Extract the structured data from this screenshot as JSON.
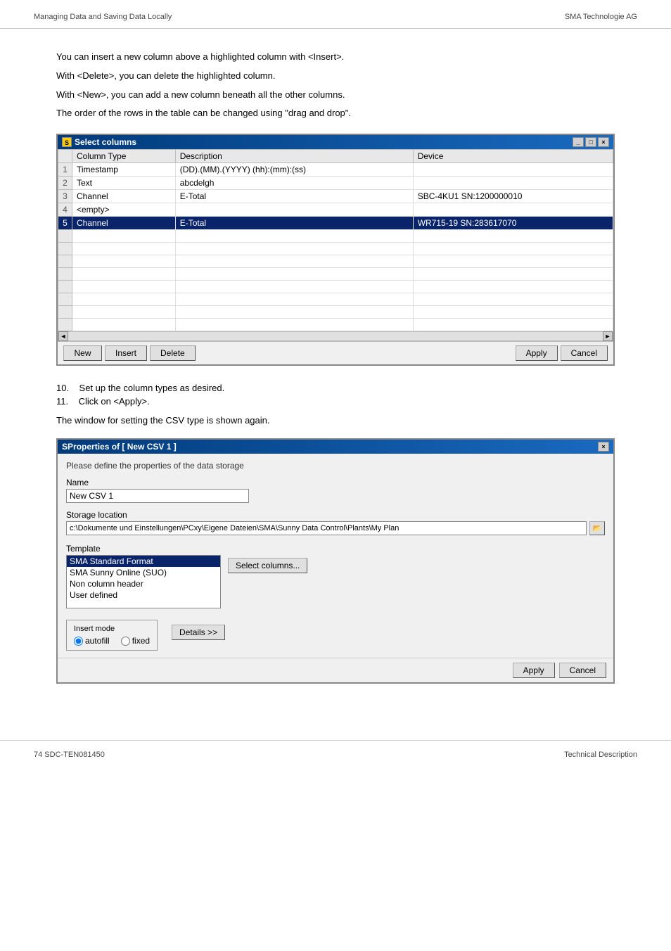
{
  "header": {
    "left": "Managing Data and Saving Data Locally",
    "right": "SMA Technologie AG"
  },
  "intro_lines": [
    "You can insert a new column above a highlighted column with <Insert>.",
    "With <Delete>, you can delete the highlighted column.",
    "With <New>, you can add a new column beneath all the other columns.",
    "The order of the rows in the table can be changed using \"drag and drop\"."
  ],
  "select_columns_window": {
    "title": "Select columns",
    "controls": [
      "-",
      "□",
      "×"
    ],
    "table_headers": [
      "Column Type",
      "Description",
      "Device"
    ],
    "rows": [
      {
        "num": "1",
        "col_type": "Timestamp",
        "description": "(DD).(MM).(YYYY) (hh):(mm):(ss)",
        "device": ""
      },
      {
        "num": "2",
        "col_type": "Text",
        "description": "abcdelgh",
        "device": ""
      },
      {
        "num": "3",
        "col_type": "Channel",
        "description": "E-Total",
        "device": "SBC-4KU1 SN:1200000010"
      },
      {
        "num": "4",
        "col_type": "<empty>",
        "description": "",
        "device": ""
      },
      {
        "num": "5",
        "col_type": "Channel",
        "description": "E-Total",
        "device": "WR715-19 SN:283617070",
        "selected": true
      }
    ],
    "buttons": {
      "new": "New",
      "insert": "Insert",
      "delete": "Delete",
      "apply": "Apply",
      "cancel": "Cancel"
    }
  },
  "steps": [
    {
      "num": "10.",
      "text": "Set up the column types as desired."
    },
    {
      "num": "11.",
      "text": "Click on <Apply>."
    }
  ],
  "step_desc": "The window for setting the CSV type is shown again.",
  "properties_window": {
    "title": "Properties of [ New CSV 1 ]",
    "close_btn": "×",
    "subtitle": "Please define the properties of the data storage",
    "name_label": "Name",
    "name_value": "New CSV 1",
    "storage_label": "Storage location",
    "storage_path": "c:\\Dokumente und Einstellungen\\PCxy\\Eigene Dateien\\SMA\\Sunny Data Control\\Plants\\My Plan",
    "browse_icon": "📁",
    "template_label": "Template",
    "template_items": [
      {
        "label": "SMA Standard Format",
        "selected": true
      },
      {
        "label": "SMA Sunny Online (SUO)",
        "selected": false
      },
      {
        "label": "Non column header",
        "selected": false
      },
      {
        "label": "User defined",
        "selected": false
      }
    ],
    "select_columns_btn": "Select columns...",
    "insert_mode_label": "Insert mode",
    "radio_autofill": "autofill",
    "radio_fixed": "fixed",
    "radio_autofill_checked": true,
    "details_btn": "Details >>",
    "apply_btn": "Apply",
    "cancel_btn": "Cancel"
  },
  "footer": {
    "left": "74     SDC-TEN081450",
    "right": "Technical Description"
  }
}
